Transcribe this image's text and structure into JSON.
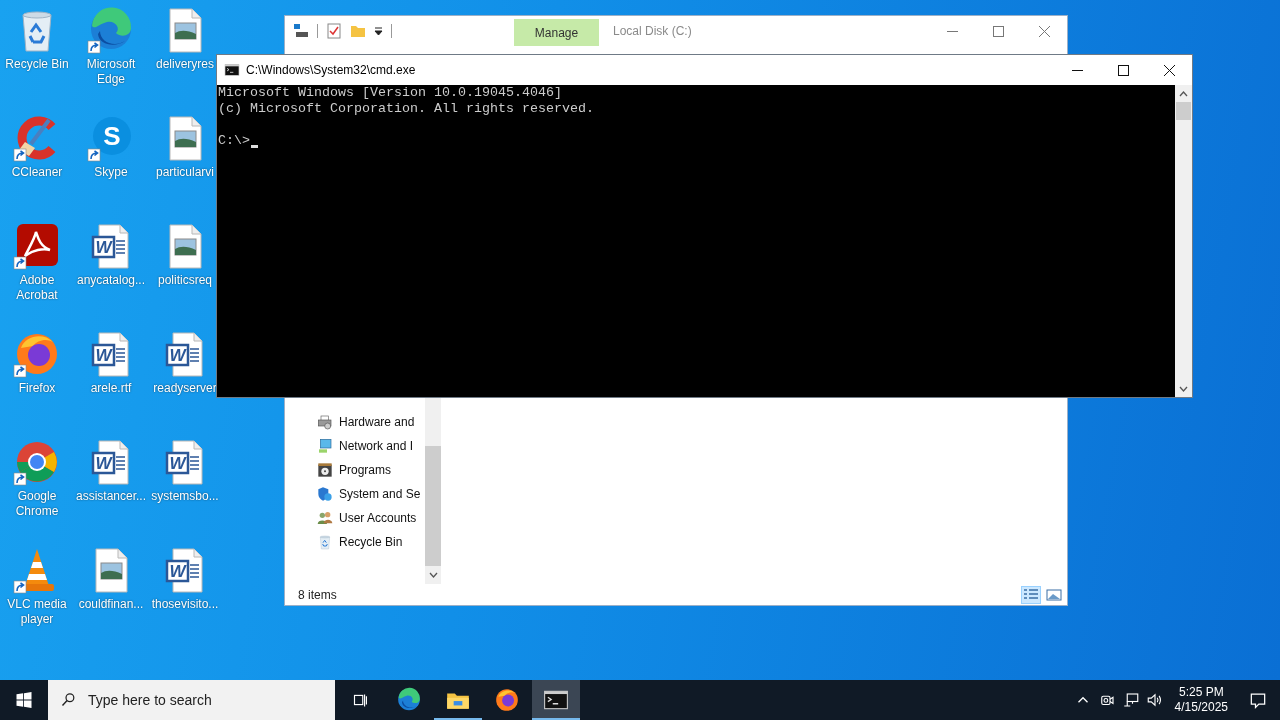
{
  "desktop_icons": [
    {
      "label": "Recycle Bin",
      "kind": "recycle-bin",
      "shortcut": false
    },
    {
      "label": "Microsoft Edge",
      "kind": "edge",
      "shortcut": true
    },
    {
      "label": "deliveryres",
      "kind": "image-file",
      "shortcut": false
    },
    {
      "label": "CCleaner",
      "kind": "ccleaner",
      "shortcut": true
    },
    {
      "label": "Skype",
      "kind": "skype",
      "shortcut": true,
      "glyph": "S"
    },
    {
      "label": "particularvi",
      "kind": "image-file",
      "shortcut": false
    },
    {
      "label": "Adobe Acrobat",
      "kind": "acrobat",
      "shortcut": true
    },
    {
      "label": "anycatalog...",
      "kind": "word-file",
      "shortcut": false,
      "glyph": "W"
    },
    {
      "label": "politicsreq",
      "kind": "image-file",
      "shortcut": false
    },
    {
      "label": "Firefox",
      "kind": "firefox",
      "shortcut": true
    },
    {
      "label": "arele.rtf",
      "kind": "word-file",
      "shortcut": false,
      "glyph": "W"
    },
    {
      "label": "readyserver",
      "kind": "word-file",
      "shortcut": false,
      "glyph": "W"
    },
    {
      "label": "Google Chrome",
      "kind": "chrome",
      "shortcut": true
    },
    {
      "label": "assistancer...",
      "kind": "word-file",
      "shortcut": false,
      "glyph": "W"
    },
    {
      "label": "systemsbo...",
      "kind": "word-file",
      "shortcut": false,
      "glyph": "W"
    },
    {
      "label": "VLC media player",
      "kind": "vlc",
      "shortcut": true
    },
    {
      "label": "couldfinan...",
      "kind": "image-file",
      "shortcut": false
    },
    {
      "label": "thosevisito...",
      "kind": "word-file",
      "shortcut": false,
      "glyph": "W"
    }
  ],
  "explorer": {
    "context_tab": "Manage",
    "title": "Local Disk (C:)",
    "nav_tree": [
      {
        "children": [
          {
            "label": "Hardware and",
            "kind": "hardware"
          },
          {
            "label": "Network and I",
            "kind": "network"
          },
          {
            "label": "Programs",
            "kind": "programs"
          },
          {
            "label": "System and Se",
            "kind": "system"
          },
          {
            "label": "User Accounts",
            "kind": "users"
          }
        ]
      },
      {
        "label": "Recycle Bin",
        "kind": "recycle-bin"
      }
    ],
    "status": "8 items",
    "view_buttons": [
      {
        "kind": "details",
        "selected": true
      },
      {
        "kind": "large-icons",
        "selected": false
      }
    ]
  },
  "cmd": {
    "title": "C:\\Windows\\System32\\cmd.exe",
    "output": [
      "Microsoft Windows [Version 10.0.19045.4046]",
      "(c) Microsoft Corporation. All rights reserved."
    ],
    "prompt": "C:\\>"
  },
  "taskbar": {
    "search": {
      "placeholder": "Type here to search"
    },
    "apps": [
      {
        "kind": "task-view",
        "running": false,
        "active": false
      },
      {
        "kind": "edge",
        "running": false,
        "active": false
      },
      {
        "kind": "explorer",
        "running": true,
        "active": false
      },
      {
        "kind": "firefox",
        "running": false,
        "active": false
      },
      {
        "kind": "cmd",
        "running": true,
        "active": true
      }
    ],
    "tray": [
      {
        "kind": "chevron"
      },
      {
        "kind": "meet"
      },
      {
        "kind": "network"
      },
      {
        "kind": "volume"
      }
    ],
    "clock": {
      "time": "5:25 PM",
      "date": "4/15/2025"
    }
  }
}
